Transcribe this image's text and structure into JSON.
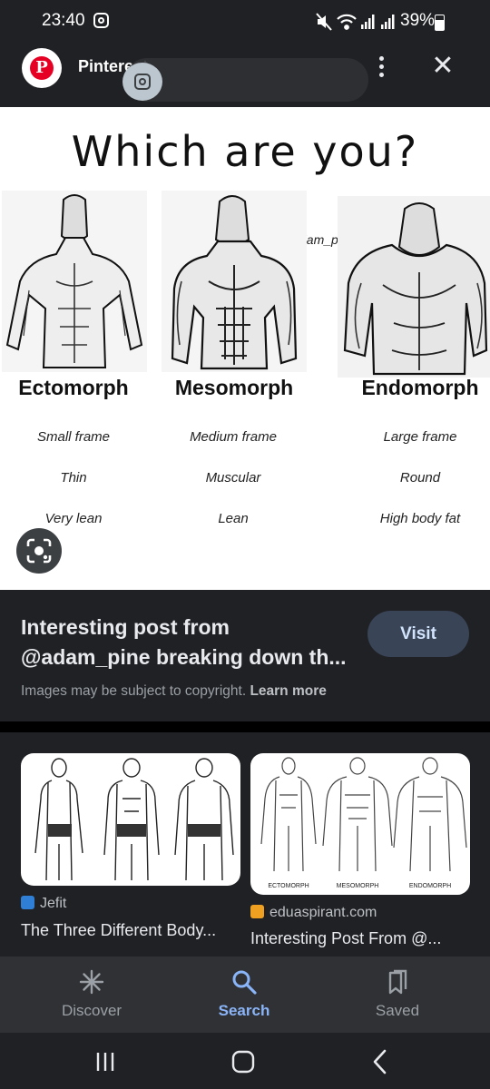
{
  "status_bar": {
    "time": "23:40",
    "battery": "39%"
  },
  "header": {
    "site_name": "Pinterest"
  },
  "image": {
    "title": "Which are you?",
    "watermark": "@adam_pine",
    "columns": [
      {
        "label": "Ectomorph",
        "traits": [
          "Small frame",
          "Thin",
          "Very lean"
        ]
      },
      {
        "label": "Mesomorph",
        "traits": [
          "Medium frame",
          "Muscular",
          "Lean"
        ]
      },
      {
        "label": "Endomorph",
        "traits": [
          "Large frame",
          "Round",
          "High body fat"
        ]
      }
    ]
  },
  "info": {
    "title_line1": "Interesting post from",
    "title_line2": "@adam_pine breaking down th...",
    "visit_label": "Visit",
    "copyright_text": "Images may be subject to copyright.",
    "learn_more": "Learn more"
  },
  "related": [
    {
      "source": "Jefit",
      "title": "The Three Different Body..."
    },
    {
      "source": "eduaspirant.com",
      "title": "Interesting Post From @...",
      "image_labels": [
        "ECTOMORPH",
        "MESOMORPH",
        "ENDOMORPH"
      ]
    }
  ],
  "bottom_nav": [
    {
      "label": "Discover",
      "icon": "asterisk-icon"
    },
    {
      "label": "Search",
      "icon": "search-icon",
      "active": true
    },
    {
      "label": "Saved",
      "icon": "bookmarks-icon"
    }
  ],
  "colors": {
    "accent": "#8ab4f8",
    "pinterest": "#e60023",
    "background": "#202124"
  }
}
